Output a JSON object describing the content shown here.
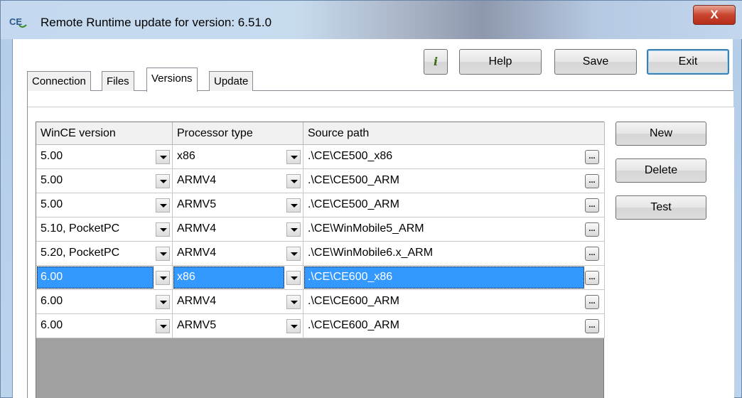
{
  "window": {
    "title": "Remote Runtime update for version: 6.51.0",
    "close_label": "X",
    "icon": "ce-app-icon"
  },
  "toolbar": {
    "info_label": "i",
    "help_label": "Help",
    "save_label": "Save",
    "exit_label": "Exit"
  },
  "tabs": [
    {
      "label": "Connection"
    },
    {
      "label": "Files"
    },
    {
      "label": "Versions"
    },
    {
      "label": "Update"
    }
  ],
  "grid": {
    "headers": [
      "WinCE version",
      "Processor type",
      "Source path"
    ],
    "rows": [
      {
        "wince": "5.00",
        "processor": "x86",
        "path": ".\\CE\\CE500_x86"
      },
      {
        "wince": "5.00",
        "processor": "ARMV4",
        "path": ".\\CE\\CE500_ARM"
      },
      {
        "wince": "5.00",
        "processor": "ARMV5",
        "path": ".\\CE\\CE500_ARM"
      },
      {
        "wince": "5.10, PocketPC",
        "processor": "ARMV4",
        "path": ".\\CE\\WinMobile5_ARM"
      },
      {
        "wince": "5.20, PocketPC",
        "processor": "ARMV4",
        "path": ".\\CE\\WinMobile6.x_ARM"
      },
      {
        "wince": "6.00",
        "processor": "x86",
        "path": ".\\CE\\CE600_x86"
      },
      {
        "wince": "6.00",
        "processor": "ARMV4",
        "path": ".\\CE\\CE600_ARM"
      },
      {
        "wince": "6.00",
        "processor": "ARMV5",
        "path": ".\\CE\\CE600_ARM"
      }
    ],
    "selected_row": 5,
    "browse_label": "..."
  },
  "side_buttons": {
    "new_label": "New",
    "delete_label": "Delete",
    "test_label": "Test"
  },
  "colors": {
    "selection": "#3399ff",
    "close_button": "#c9452f"
  }
}
